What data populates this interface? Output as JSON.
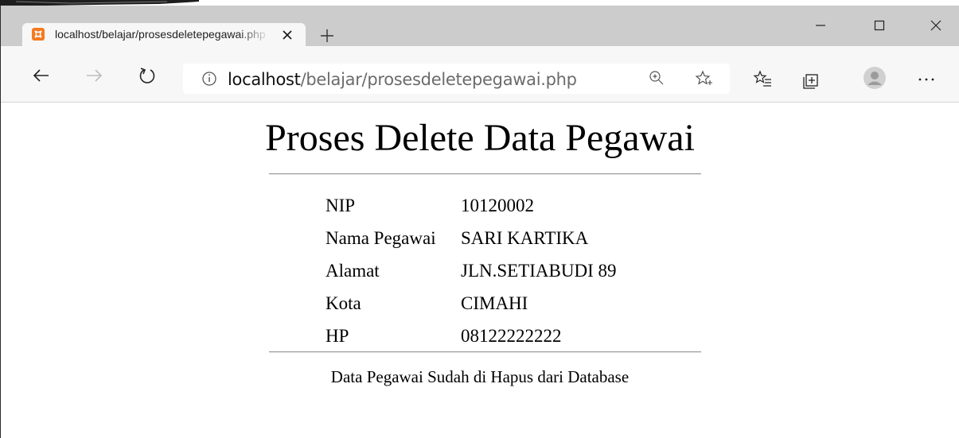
{
  "tab": {
    "title": "localhost/belajar/prosesdeletepegawai.php",
    "favicon": "xampp-icon",
    "favicon_color": "#f47a20"
  },
  "address_bar": {
    "host": "localhost",
    "path": "/belajar/prosesdeletepegawai.php"
  },
  "page": {
    "title": "Proses Delete Data Pegawai",
    "fields": [
      {
        "label": "NIP",
        "value": "10120002"
      },
      {
        "label": "Nama Pegawai",
        "value": "SARI KARTIKA"
      },
      {
        "label": "Alamat",
        "value": "JLN.SETIABUDI 89"
      },
      {
        "label": "Kota",
        "value": "CIMAHI"
      },
      {
        "label": "HP",
        "value": "08122222222"
      }
    ],
    "status_message": "Data Pegawai Sudah di Hapus dari Database"
  },
  "colors": {
    "tabstrip_bg": "#cccccc",
    "toolbar_bg": "#f7f7f7",
    "page_bg": "#ffffff"
  }
}
